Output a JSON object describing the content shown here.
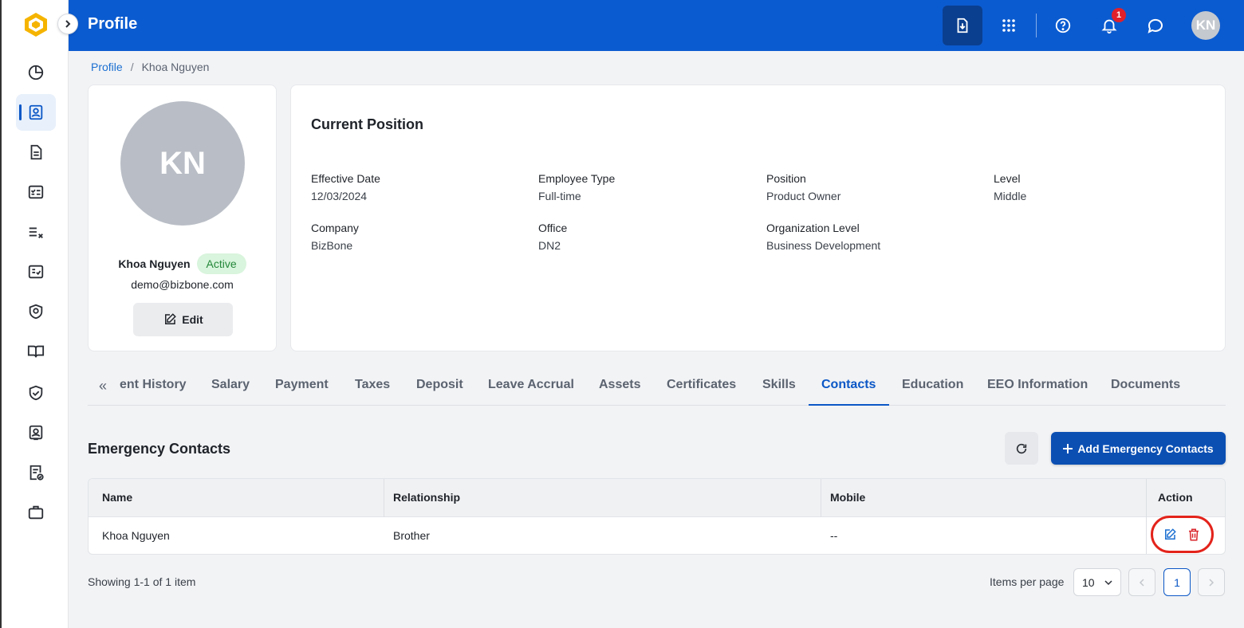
{
  "header": {
    "title": "Profile",
    "notification_count": "1",
    "user_initials": "KN"
  },
  "breadcrumb": {
    "root": "Profile",
    "current": "Khoa Nguyen"
  },
  "profile": {
    "initials": "KN",
    "name": "Khoa Nguyen",
    "status": "Active",
    "email": "demo@bizbone.com",
    "edit_label": "Edit"
  },
  "position": {
    "title": "Current Position",
    "fields": [
      {
        "label": "Effective Date",
        "value": "12/03/2024"
      },
      {
        "label": "Employee Type",
        "value": "Full-time"
      },
      {
        "label": "Position",
        "value": "Product Owner"
      },
      {
        "label": "Level",
        "value": "Middle"
      },
      {
        "label": "Company",
        "value": "BizBone"
      },
      {
        "label": "Office",
        "value": "DN2"
      },
      {
        "label": "Organization Level",
        "value": "Business Development"
      }
    ]
  },
  "tabs": {
    "scroll_glyph": "«",
    "items": [
      {
        "label": "ent History"
      },
      {
        "label": "Salary"
      },
      {
        "label": "Payment"
      },
      {
        "label": "Taxes"
      },
      {
        "label": "Deposit"
      },
      {
        "label": "Leave Accrual"
      },
      {
        "label": "Assets"
      },
      {
        "label": "Certificates"
      },
      {
        "label": "Skills"
      },
      {
        "label": "Contacts"
      },
      {
        "label": "Education"
      },
      {
        "label": "EEO Information"
      },
      {
        "label": "Documents"
      }
    ],
    "active": "Contacts"
  },
  "emergency": {
    "title": "Emergency Contacts",
    "add_label": "Add Emergency Contacts",
    "columns": [
      "Name",
      "Relationship",
      "Mobile",
      "Action"
    ],
    "rows": [
      {
        "name": "Khoa Nguyen",
        "relationship": "Brother",
        "mobile": "--"
      }
    ]
  },
  "pagination": {
    "showing": "Showing 1-1 of 1 item",
    "items_per_page_label": "Items per page",
    "items_per_page": "10",
    "current_page": "1"
  },
  "colors": {
    "brand": "#0b5bd0",
    "primary_button": "#0b4fb3",
    "active_status_bg": "#d9f5dd",
    "delete_icon": "#d9262c",
    "highlight": "#e3231b"
  },
  "icons": {
    "sidebar": [
      "dashboard-icon",
      "profile-icon",
      "document-icon",
      "checklist-icon",
      "task-list-icon",
      "checkbox-list-icon",
      "security-badge-icon",
      "book-icon",
      "shield-check-icon",
      "user-card-icon",
      "report-check-icon",
      "briefcase-icon"
    ],
    "topbar": [
      "download-icon",
      "apps-grid-icon",
      "help-icon",
      "bell-icon",
      "chat-icon"
    ]
  }
}
